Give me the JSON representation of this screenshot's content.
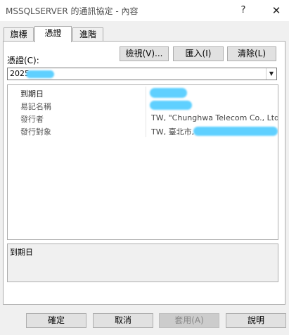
{
  "window": {
    "title": "MSSQLSERVER 的通訊協定 - 內容",
    "help_glyph": "?",
    "close_glyph": "✕"
  },
  "tabs": [
    {
      "label": "旗標",
      "active": false
    },
    {
      "label": "憑證",
      "active": true
    },
    {
      "label": "進階",
      "active": false
    }
  ],
  "certificate": {
    "label": "憑證(C):",
    "selected_value": "2025",
    "view_label": "檢視(V)...",
    "import_label": "匯入(I)",
    "clear_label": "清除(L)",
    "dropdown_glyph": "▼"
  },
  "properties": [
    {
      "name": "到期日",
      "value": ""
    },
    {
      "name": "易記名稱",
      "value": ""
    },
    {
      "name": "發行者",
      "value": "TW, \"Chunghwa Telecom Co., Ltd.\""
    },
    {
      "name": "發行對象",
      "value": "TW, 臺北市,"
    }
  ],
  "description": {
    "text": "到期日"
  },
  "buttons": {
    "ok": "確定",
    "cancel": "取消",
    "apply": "套用(A)",
    "help": "說明"
  },
  "colors": {
    "redaction": "#5fd0ff",
    "panel_border": "#adadad"
  }
}
